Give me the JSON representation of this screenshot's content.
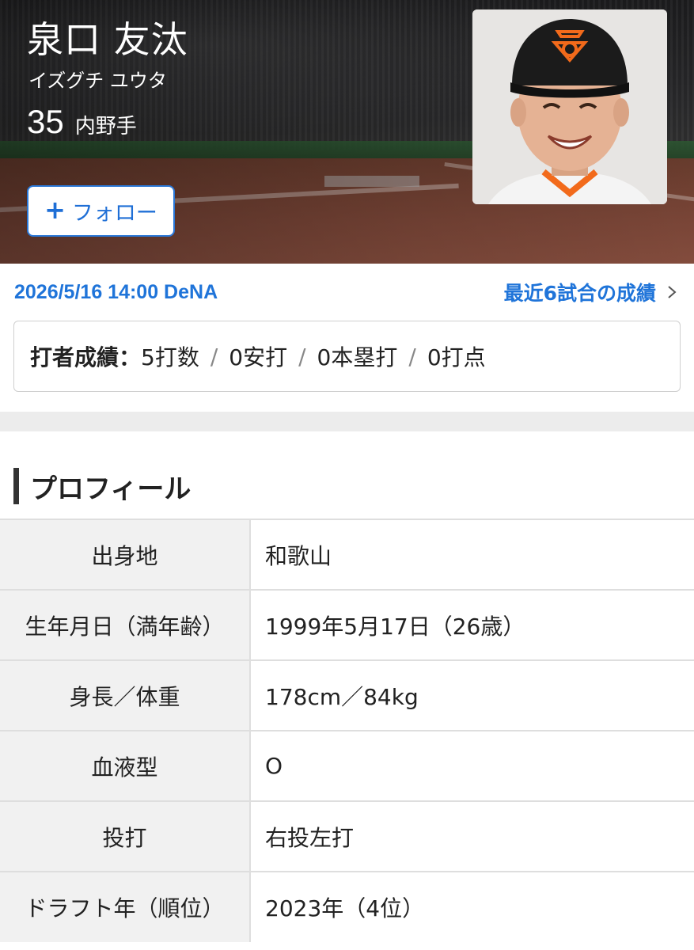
{
  "player": {
    "name": "泉口 友汰",
    "kana": "イズグチ ユウタ",
    "number": "35",
    "position": "内野手",
    "follow_label": "フォロー",
    "follow_icon": "plus-icon"
  },
  "game": {
    "date_opponent": "2026/5/16 14:00  DeNA",
    "recent_link": "最近6試合の成績",
    "batting_label": "打者成績：",
    "stats": [
      "5打数",
      "0安打",
      "0本塁打",
      "0打点"
    ],
    "separator": "/"
  },
  "profile": {
    "title": "プロフィール",
    "rows": [
      {
        "key": "出身地",
        "value": "和歌山"
      },
      {
        "key": "生年月日（満年齢）",
        "value": "1999年5月17日（26歳）"
      },
      {
        "key": "身長／体重",
        "value": "178cm／84kg"
      },
      {
        "key": "血液型",
        "value": "O"
      },
      {
        "key": "投打",
        "value": "右投左打"
      },
      {
        "key": "ドラフト年（順位）",
        "value": "2023年（4位）"
      }
    ]
  },
  "colors": {
    "accent": "#1f74d9",
    "cap_logo": "#f26a1b"
  }
}
